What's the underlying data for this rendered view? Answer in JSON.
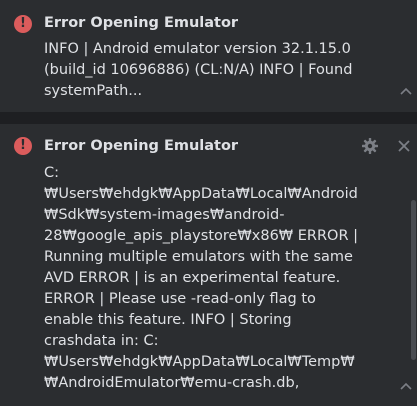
{
  "notifications": [
    {
      "title": "Error Opening Emulator",
      "body": "INFO | Android emulator version 32.1.15.0 (build_id 10696886) (CL:N/A) INFO | Found systemPath..."
    },
    {
      "title": "Error Opening Emulator",
      "body": "C:₩Users₩ehdgk₩AppData₩Local₩Android₩Sdk₩system-images₩android-28₩google_apis_playstore₩x86₩ ERROR | Running multiple emulators with the same AVD ERROR | is an experimental feature. ERROR | Please use -read-only flag to enable this feature. INFO | Storing crashdata in: C:₩Users₩ehdgk₩AppData₩Local₩Temp₩₩AndroidEmulator₩emu-crash.db, detection is enabled INFO | Duplicate loglines will be"
    }
  ],
  "icons": {
    "error": "error-icon",
    "settings": "gear-icon",
    "close": "close-icon",
    "collapse": "chevron-up-icon"
  },
  "colors": {
    "background": "#1e1f22",
    "panel": "#2b2d30",
    "text": "#dfe1e5",
    "error": "#db5c5c",
    "icon": "#7c7f86"
  }
}
